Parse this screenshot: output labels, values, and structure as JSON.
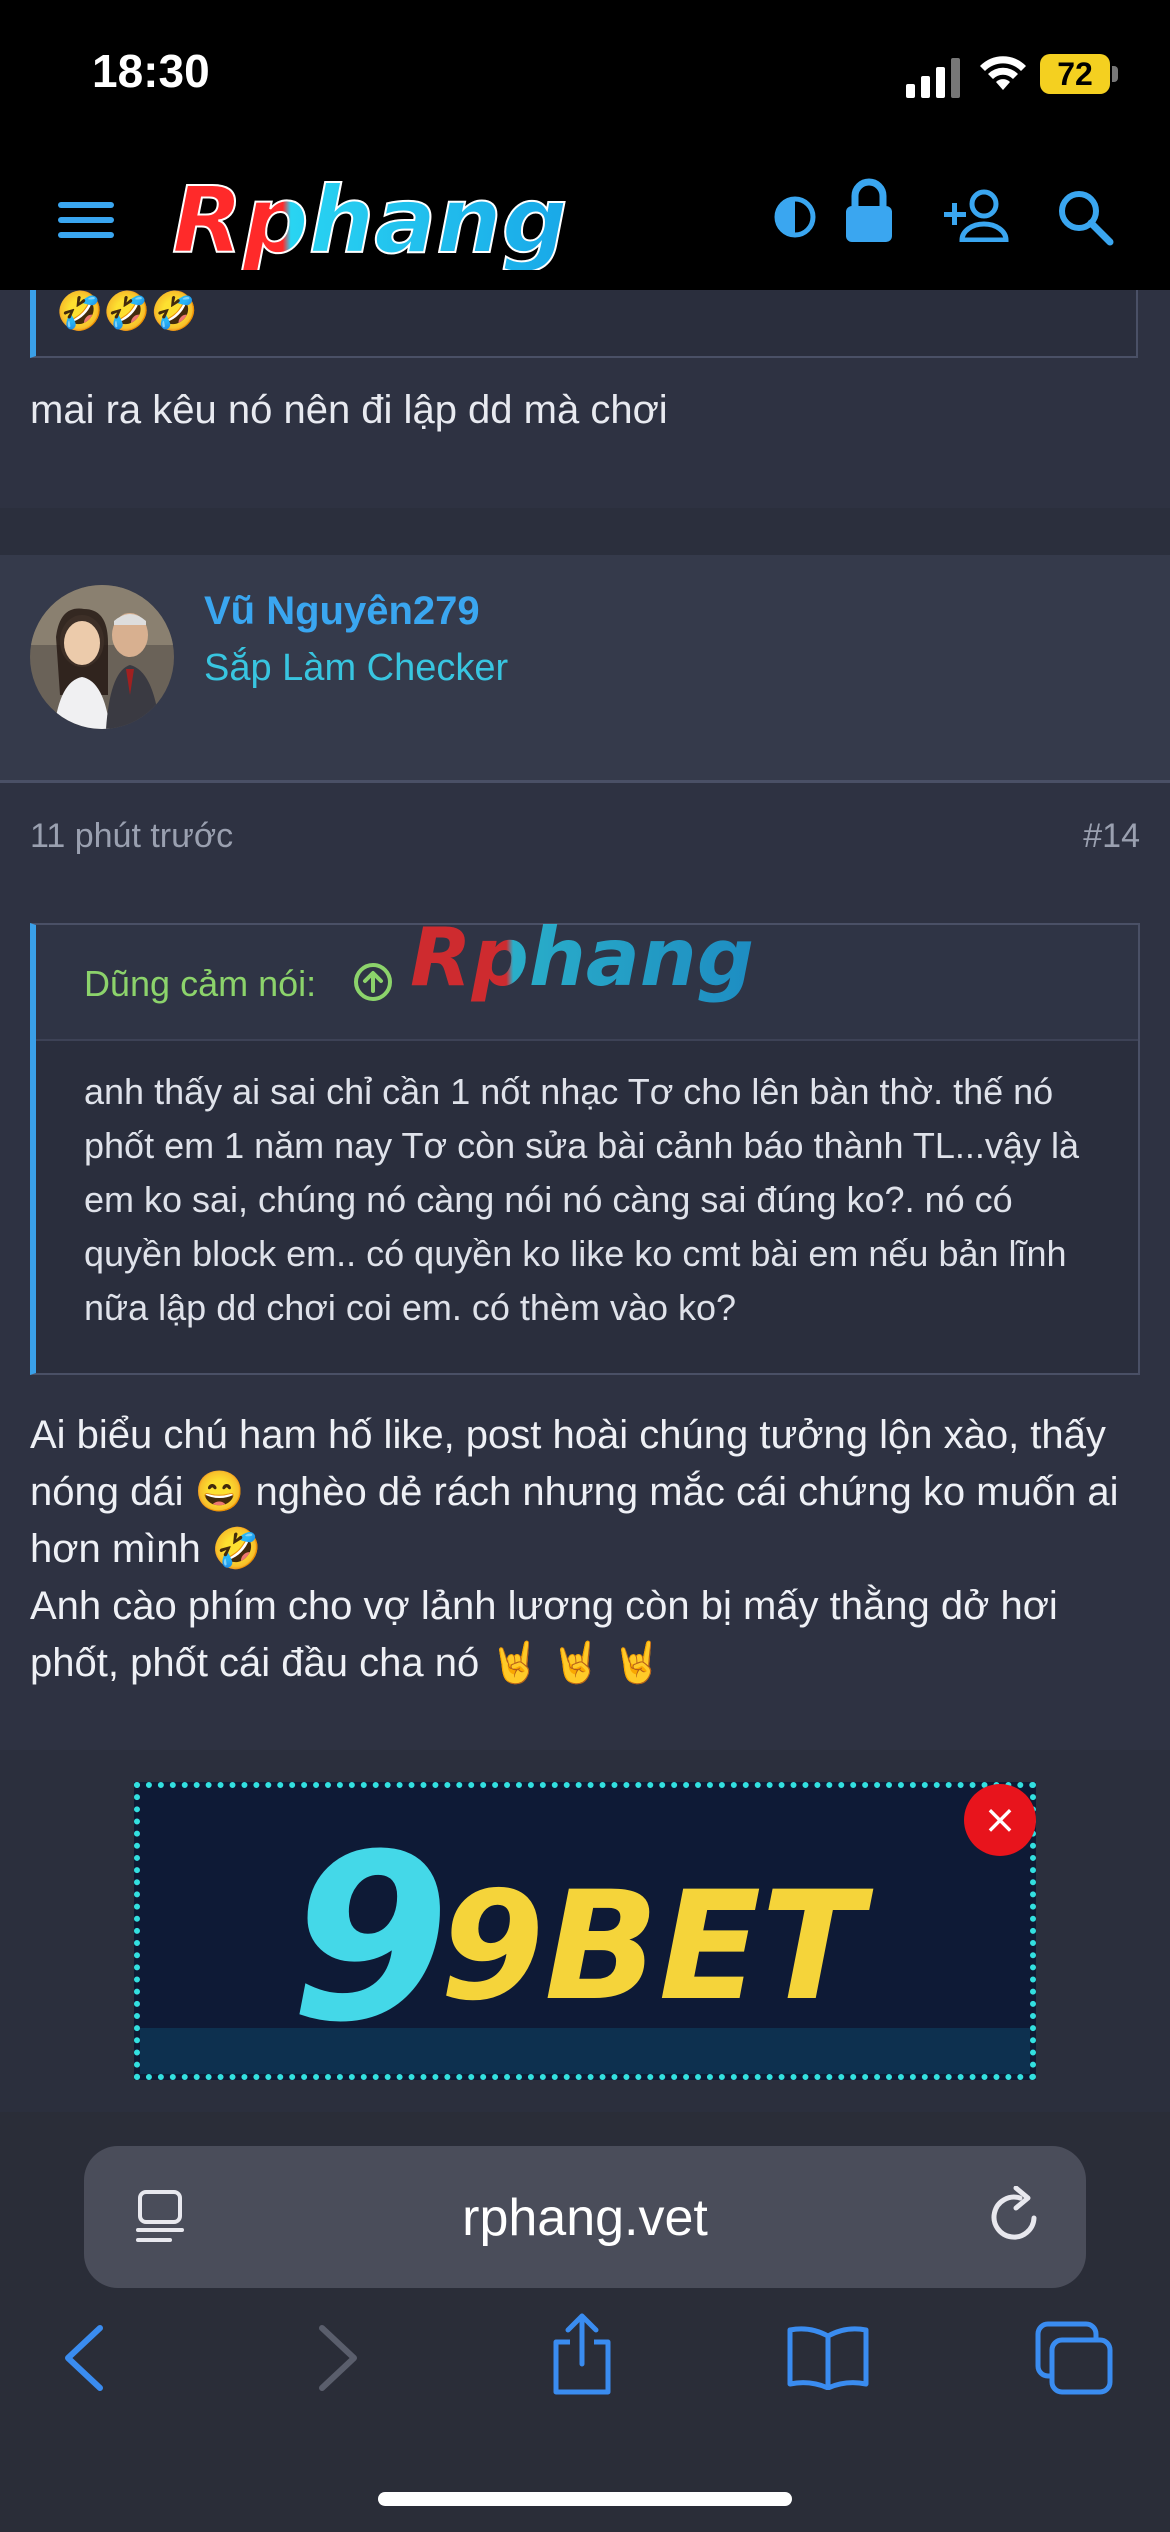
{
  "status": {
    "time": "18:30",
    "battery": "72"
  },
  "header": {
    "logo_text": "Rphang",
    "icons": [
      "menu-icon",
      "theme-toggle-icon",
      "lock-icon",
      "add-user-icon",
      "search-icon"
    ]
  },
  "prev_post": {
    "emoji": "🤣🤣🤣",
    "text": "mai ra kêu nó nên đi lập dd mà chơi"
  },
  "post": {
    "username": "Vũ Nguyên279",
    "user_title": "Sắp Làm Checker",
    "time": "11 phút trước",
    "number": "#14",
    "quote_author": "Dũng cảm nói:",
    "quote_text": "anh thấy ai sai chỉ cần 1 nốt nhạc Tơ cho lên bàn thờ. thế nó phốt em 1 năm nay Tơ còn sửa bài cảnh báo thành TL...vậy là em ko sai, chúng nó càng nói nó càng sai đúng ko?. nó có quyền block em.. có quyền ko like ko cmt bài em nếu bản lĩnh nữa lập dd chơi coi em. có thèm vào ko?",
    "reply_line1": "Ai biểu chú ham hố like, post hoài chúng tưởng lộn xào, thấy nóng dái 😄 nghèo dẻ rách nhưng mắc cái chứng ko muốn ai hơn mình 🤣",
    "reply_line2": "Anh cào phím cho vợ lảnh lương còn bị mấy thằng dở hơi phốt, phốt cái đầu cha nó 🤘 🤘 🤘"
  },
  "ad": {
    "text": "9BET",
    "close": "×"
  },
  "browser": {
    "url": "rphang.vet"
  }
}
